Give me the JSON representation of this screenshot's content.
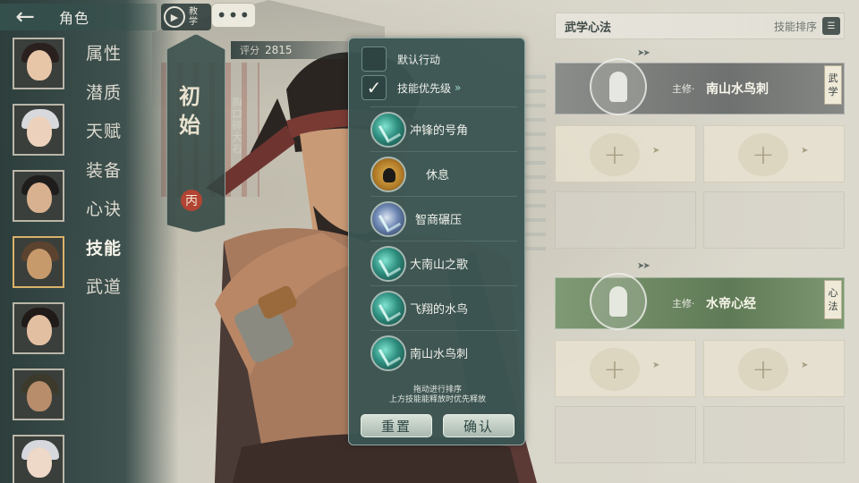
{
  "header": {
    "back_title": "角色",
    "teach_label": "教学",
    "more_label": "•••"
  },
  "sidebar": {
    "menu": [
      "属性",
      "潜质",
      "天赋",
      "装备",
      "心诀",
      "技能",
      "武道"
    ],
    "active_index": 5
  },
  "character": {
    "name": "初始",
    "subtitle": "胸口碎大石",
    "seal": "丙",
    "score_label": "评分",
    "score": "2815"
  },
  "popup": {
    "default_action": "默认行动",
    "priority": "技能优先级",
    "priority_arrow": "»",
    "skills": [
      {
        "name": "冲锋的号角",
        "icon": "horn-skill-icon"
      },
      {
        "name": "休息",
        "icon": "meditate-skill-icon"
      },
      {
        "name": "智商碾压",
        "icon": "crush-skill-icon"
      },
      {
        "name": "大南山之歌",
        "icon": "song-skill-icon"
      },
      {
        "name": "飞翔的水鸟",
        "icon": "waterbird-skill-icon"
      },
      {
        "name": "南山水鸟刺",
        "icon": "stab-skill-icon"
      }
    ],
    "hint_line1": "拖动进行排序",
    "hint_line2": "上方技能能释放时优先释放",
    "reset": "重置",
    "confirm": "确认"
  },
  "right": {
    "title": "武学心法",
    "sort_label": "技能排序",
    "martial": {
      "prefix": "主修·",
      "name": "南山水鸟刺",
      "tag": "武学"
    },
    "heart": {
      "prefix": "主修·",
      "name": "水帝心经",
      "tag": "心法"
    }
  },
  "colors": {
    "sidebar": "#34504d",
    "popup": "#3a5452",
    "martial_bar": "#7a7d7a",
    "heart_bar": "#6a8560",
    "seal": "#b24433",
    "active_portrait": "#d9b26a"
  }
}
